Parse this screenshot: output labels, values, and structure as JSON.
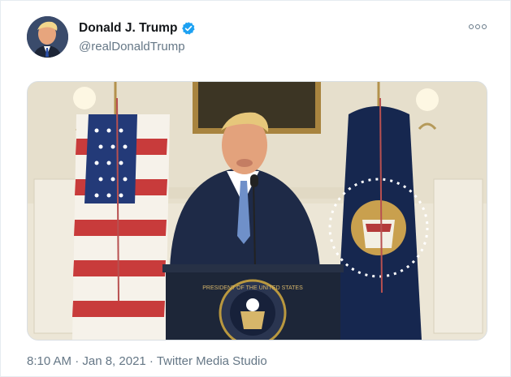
{
  "tweet": {
    "display_name": "Donald J. Trump",
    "handle": "@realDonaldTrump",
    "verified": true,
    "timestamp": "8:10 AM · Jan 8, 2021 · Twitter Media Studio"
  },
  "icons": {
    "verified": "verified-badge-icon",
    "more": "more-options-icon"
  },
  "media": {
    "type": "video-thumbnail",
    "seal_text": "PRESIDENT OF THE UNITED STATES"
  },
  "colors": {
    "verified_blue": "#1da1f2",
    "name_text": "#14171a",
    "secondary_text": "#657786"
  }
}
